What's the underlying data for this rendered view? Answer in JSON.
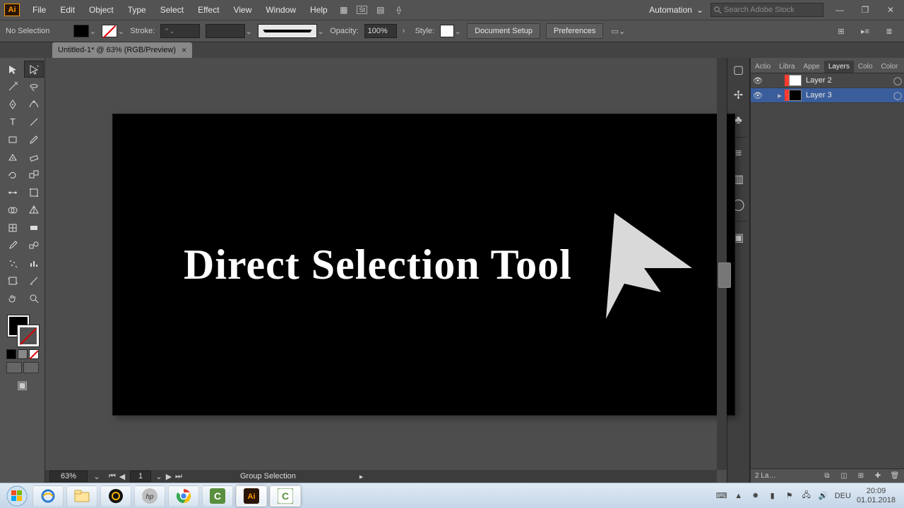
{
  "menubar": {
    "items": [
      "File",
      "Edit",
      "Object",
      "Type",
      "Select",
      "Effect",
      "View",
      "Window",
      "Help"
    ],
    "automation": "Automation",
    "search_placeholder": "Search Adobe Stock"
  },
  "controlbar": {
    "selection": "No Selection",
    "stroke_label": "Stroke:",
    "opacity_label": "Opacity:",
    "opacity_value": "100%",
    "style_label": "Style:",
    "doc_setup": "Document Setup",
    "preferences": "Preferences"
  },
  "doc_tab": {
    "title": "Untitled-1* @ 63% (RGB/Preview)"
  },
  "canvas": {
    "text": "Direct Selection Tool"
  },
  "status": {
    "zoom": "63%",
    "artboard": "1",
    "tool": "Group Selection"
  },
  "panels": {
    "tabs": [
      "Actio",
      "Libra",
      "Appe",
      "Layers",
      "Colo",
      "Color"
    ],
    "active_tab": 3,
    "layers": [
      {
        "name": "Layer 2",
        "color": "#ff3b30",
        "thumb": "#ffffff",
        "selected": false,
        "expandable": false
      },
      {
        "name": "Layer 3",
        "color": "#ff3b30",
        "thumb": "#000000",
        "selected": true,
        "expandable": true
      }
    ],
    "footer_count": "2 La…"
  },
  "taskbar": {
    "lang": "DEU",
    "time": "20:09",
    "date": "01.01.2018"
  }
}
